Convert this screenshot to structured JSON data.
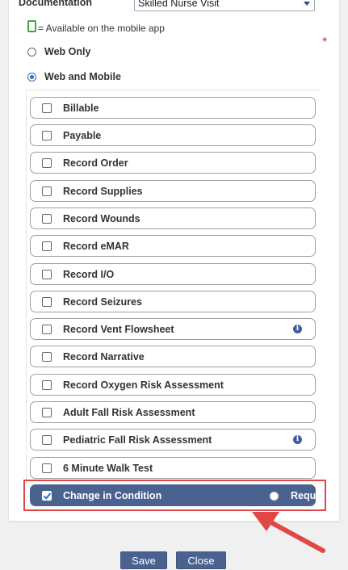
{
  "documentation": {
    "label": "Documentation",
    "selected": "Skilled Nurse Visit"
  },
  "mobile_note": "= Available on the mobile app",
  "required_marker": "*",
  "availability": {
    "options": [
      {
        "label": "Web Only",
        "selected": false
      },
      {
        "label": "Web and Mobile",
        "selected": true
      }
    ]
  },
  "items": [
    {
      "label": "Billable",
      "checked": false,
      "info": false
    },
    {
      "label": "Payable",
      "checked": false,
      "info": false
    },
    {
      "label": "Record Order",
      "checked": false,
      "info": false
    },
    {
      "label": "Record Supplies",
      "checked": false,
      "info": false
    },
    {
      "label": "Record Wounds",
      "checked": false,
      "info": false
    },
    {
      "label": "Record eMAR",
      "checked": false,
      "info": false
    },
    {
      "label": "Record I/O",
      "checked": false,
      "info": false
    },
    {
      "label": "Record Seizures",
      "checked": false,
      "info": false
    },
    {
      "label": "Record Vent Flowsheet",
      "checked": false,
      "info": true
    },
    {
      "label": "Record Narrative",
      "checked": false,
      "info": false
    },
    {
      "label": "Record Oxygen Risk Assessment",
      "checked": false,
      "info": false
    },
    {
      "label": "Adult Fall Risk Assessment",
      "checked": false,
      "info": false
    },
    {
      "label": "Pediatric Fall Risk Assessment",
      "checked": false,
      "info": true
    },
    {
      "label": "6 Minute Walk Test",
      "checked": false,
      "info": false
    },
    {
      "label": "Change in Condition",
      "checked": true,
      "info": false,
      "required_label": "Required",
      "required": false
    }
  ],
  "info_glyph": "i",
  "buttons": {
    "save": "Save",
    "close": "Close"
  },
  "colors": {
    "accent": "#4a6290",
    "highlight": "#e04848",
    "mobile_icon": "#3cab3c"
  }
}
